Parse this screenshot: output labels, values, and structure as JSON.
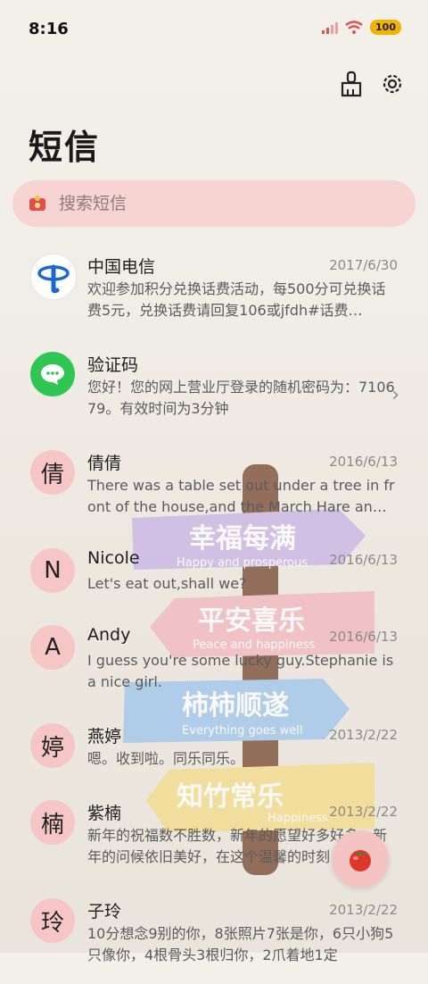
{
  "status": {
    "time": "8:16",
    "battery": "100"
  },
  "header": {
    "title": "短信"
  },
  "search": {
    "placeholder": "搜索短信"
  },
  "conversations": [
    {
      "avatar": "",
      "name": "中国电信",
      "date": "2017/6/30",
      "preview": "欢迎参加积分兑换话费活动，每500分可兑换话费5元，兑换话费请回复106或jfdh#话费…"
    },
    {
      "avatar": "",
      "name": "验证码",
      "date": "",
      "preview": "您好！您的网上营业厅登录的随机密码为：710679。有效时间为3分钟"
    },
    {
      "avatar": "倩",
      "name": "倩倩",
      "date": "2016/6/13",
      "preview": "There was a table set out under a tree in front of the house,and the March Hare an…"
    },
    {
      "avatar": "N",
      "name": "Nicole",
      "date": "2016/6/13",
      "preview": "Let's eat out,shall we?"
    },
    {
      "avatar": "A",
      "name": "Andy",
      "date": "2016/6/13",
      "preview": "I guess you're some lucky guy.Stephanie is a nice girl."
    },
    {
      "avatar": "婷",
      "name": "燕婷",
      "date": "2013/2/22",
      "preview": "嗯。收到啦。同乐同乐。"
    },
    {
      "avatar": "楠",
      "name": "紫楠",
      "date": "2013/2/22",
      "preview": "新年的祝福数不胜数，新年的愿望好多好多，新年的问候依旧美好，在这个温馨的时刻 …"
    },
    {
      "avatar": "玲",
      "name": "子玲",
      "date": "2013/2/22",
      "preview": "10分想念9别的你，8张照片7张是你，6只小狗5只像你，4根骨头3根归你，2爪着地1定"
    }
  ],
  "decor": {
    "signs": [
      {
        "cn": "幸福每满",
        "en": "Happy and prosperous",
        "color": "#c9b5e6"
      },
      {
        "cn": "平安喜乐",
        "en": "Peace and happiness",
        "color": "#f2b8c0"
      },
      {
        "cn": "柿柿顺遂",
        "en": "Everything goes well",
        "color": "#9fc6ec"
      },
      {
        "cn": "知竹常乐",
        "en": "Happiness",
        "color": "#f4dc8a"
      }
    ]
  },
  "icons": {
    "clean": "broom-icon",
    "settings": "gear-icon",
    "search": "envelope-icon",
    "fab": "tomato-icon"
  }
}
